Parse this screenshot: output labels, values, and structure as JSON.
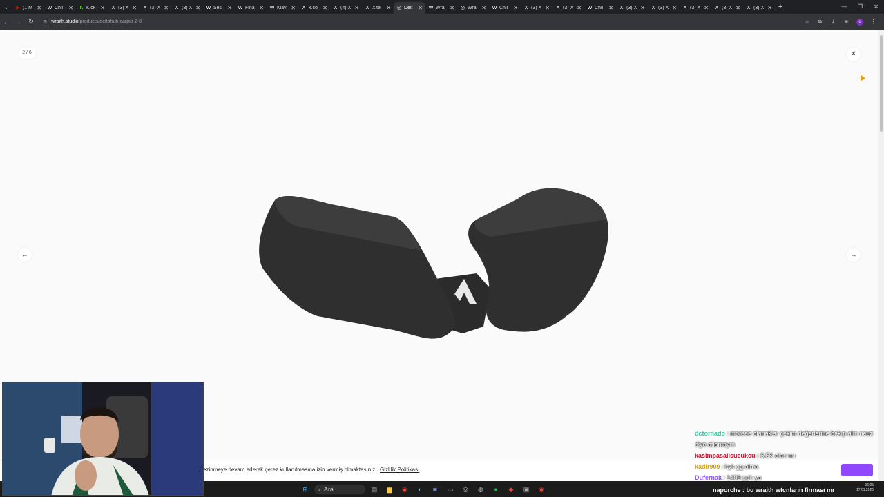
{
  "browser": {
    "tabs": [
      {
        "icon": "▶",
        "color": "#ff0000",
        "title": "(1 M"
      },
      {
        "icon": "W",
        "color": "#ffffff",
        "title": "Chil"
      },
      {
        "icon": "K",
        "color": "#53fc18",
        "title": "Kick"
      },
      {
        "icon": "X",
        "color": "#ffffff",
        "title": "(3) X"
      },
      {
        "icon": "X",
        "color": "#ffffff",
        "title": "(3) X"
      },
      {
        "icon": "X",
        "color": "#ffffff",
        "title": "(3) X"
      },
      {
        "icon": "W",
        "color": "#ffffff",
        "title": "Ses"
      },
      {
        "icon": "W",
        "color": "#ffffff",
        "title": "Fina"
      },
      {
        "icon": "W",
        "color": "#ffffff",
        "title": "Klav"
      },
      {
        "icon": "X",
        "color": "#ffffff",
        "title": "x.co"
      },
      {
        "icon": "X",
        "color": "#ffffff",
        "title": "(4) X"
      },
      {
        "icon": "X",
        "color": "#ffffff",
        "title": "X'te"
      },
      {
        "icon": "◎",
        "color": "#ffffff",
        "title": "Delt"
      },
      {
        "icon": "W",
        "color": "#ffffff",
        "title": "Wra"
      },
      {
        "icon": "◎",
        "color": "#ffffff",
        "title": "Wra"
      },
      {
        "icon": "W",
        "color": "#ffffff",
        "title": "Chil"
      },
      {
        "icon": "X",
        "color": "#ffffff",
        "title": "(3) X"
      },
      {
        "icon": "X",
        "color": "#ffffff",
        "title": "(3) X"
      },
      {
        "icon": "W",
        "color": "#ffffff",
        "title": "Chil"
      },
      {
        "icon": "X",
        "color": "#ffffff",
        "title": "(3) X"
      },
      {
        "icon": "X",
        "color": "#ffffff",
        "title": "(3) X"
      },
      {
        "icon": "X",
        "color": "#ffffff",
        "title": "(3) X"
      },
      {
        "icon": "X",
        "color": "#ffffff",
        "title": "(3) X"
      },
      {
        "icon": "X",
        "color": "#ffffff",
        "title": "(3) X"
      }
    ],
    "active_tab_index": 12,
    "url_host": "wraith.studio",
    "url_path": "/products/deltahub-carpio-2-0",
    "profile_initial": "c"
  },
  "gallery": {
    "counter": "2 / 6",
    "close_icon": "close-icon",
    "prev_icon": "arrow-left-icon",
    "next_icon": "arrow-right-icon",
    "product_color": "#2a2a2a"
  },
  "cookie_banner": {
    "message": "ezinmeye devam ederek çerez kullanılmasına izin vermiş olmaktasınız.",
    "link": "Gizlilik Politikası"
  },
  "taskbar": {
    "search_label": "Ara",
    "ticker": "naporche : bu wraith wtcnların firması mı",
    "clock_time": "06:05",
    "clock_date": "17.01.2026"
  },
  "chat": [
    {
      "user": "dctornado",
      "color": "#3ec7a0",
      "text": ": moreee olanaklar çekim değerlerine bakıp alın neuz"
    },
    {
      "user": "",
      "color": "#ffffff",
      "text": "diye atlamayın"
    },
    {
      "user": "kasimpasalisucukcu",
      "color": "#c8102e",
      "text": ": 6.5K olan mı"
    },
    {
      "user": "kadir909",
      "color": "#d4a017",
      "text": ": kyk gg alma"
    },
    {
      "user": "Dufernak",
      "color": "#8a4fff",
      "text": ": 1400 pph ya"
    }
  ]
}
